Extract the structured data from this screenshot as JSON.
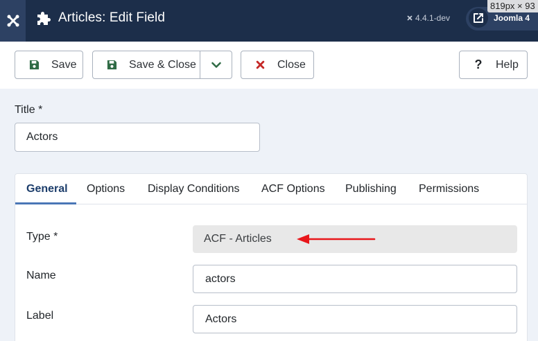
{
  "header": {
    "title": "Articles: Edit Field",
    "version": "4.4.1-dev",
    "site_label": "Joomla 4",
    "overlay_dims": "819px × 93"
  },
  "toolbar": {
    "save_label": "Save",
    "save_close_label": "Save & Close",
    "close_label": "Close",
    "help_label": "Help"
  },
  "title_field": {
    "label": "Title *",
    "value": "Actors"
  },
  "tabs": [
    {
      "label": "General",
      "active": true
    },
    {
      "label": "Options"
    },
    {
      "label": "Display Conditions"
    },
    {
      "label": "ACF Options"
    },
    {
      "label": "Publishing"
    },
    {
      "label": "Permissions"
    }
  ],
  "form": {
    "type_label": "Type *",
    "type_value": "ACF - Articles",
    "name_label": "Name",
    "name_value": "actors",
    "label_label": "Label",
    "label_value": "Actors"
  },
  "colors": {
    "header_bg": "#1c2e4a",
    "save_icon": "#2f6b45",
    "close_icon": "#c52827",
    "arrow": "#e8161b",
    "active_tab": "#1c3d6b"
  }
}
